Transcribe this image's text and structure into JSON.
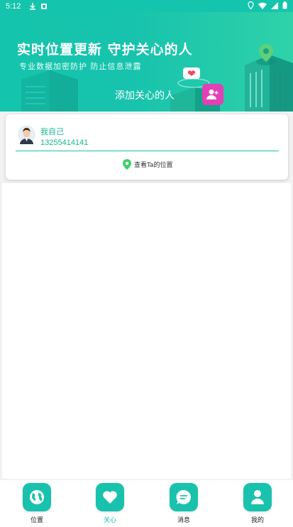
{
  "status_bar": {
    "time": "5:12"
  },
  "banner": {
    "title": "实时位置更新 守护关心的人",
    "subtitle": "专业数据加密防护 防止信息泄露",
    "add_caring_label": "添加关心的人"
  },
  "contact_card": {
    "name": "我自己",
    "phone": "13255414141",
    "view_location_label": "查看Ta的位置"
  },
  "tabs": [
    {
      "label": "位置",
      "icon": "globe-icon"
    },
    {
      "label": "关心",
      "icon": "heart-icon",
      "active": true
    },
    {
      "label": "消息",
      "icon": "chat-icon"
    },
    {
      "label": "我的",
      "icon": "person-icon"
    }
  ],
  "colors": {
    "primary": "#18c2ad",
    "accent_pink": "#e33fb6",
    "text_green": "#12b98f"
  }
}
